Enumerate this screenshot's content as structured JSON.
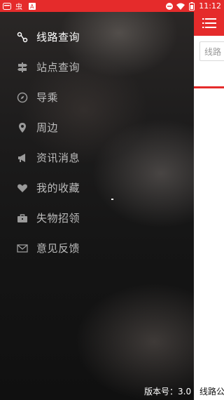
{
  "status_bar": {
    "time": "11:12",
    "left_icons": [
      "notification-icon",
      "app-icon",
      "a-icon"
    ],
    "right_icons": [
      "minus-circle-icon",
      "wifi-icon",
      "battery-icon"
    ],
    "color": "#e52b2b"
  },
  "background_app": {
    "search_placeholder": "线路",
    "footer_text": "线路公"
  },
  "drawer": {
    "menu": [
      {
        "label": "线路查询",
        "icon": "route-icon",
        "active": true
      },
      {
        "label": "站点查询",
        "icon": "signpost-icon",
        "active": false
      },
      {
        "label": "导乘",
        "icon": "compass-icon",
        "active": false
      },
      {
        "label": "周边",
        "icon": "location-pin-icon",
        "active": false
      },
      {
        "label": "资讯消息",
        "icon": "megaphone-icon",
        "active": false
      },
      {
        "label": "我的收藏",
        "icon": "heart-icon",
        "active": false
      },
      {
        "label": "失物招领",
        "icon": "briefcase-icon",
        "active": false
      },
      {
        "label": "意见反馈",
        "icon": "mail-icon",
        "active": false
      }
    ],
    "version_label": "版本号：3.0"
  },
  "colors": {
    "accent": "#e52b2b"
  }
}
